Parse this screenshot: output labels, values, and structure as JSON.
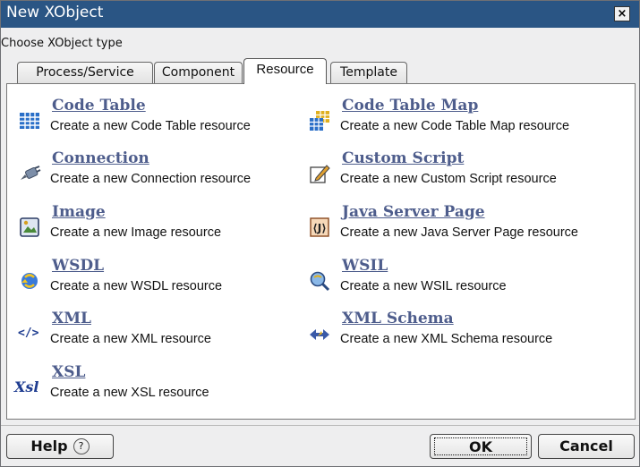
{
  "window": {
    "title": "New XObject",
    "close_glyph": "×"
  },
  "subtitle": "Choose XObject type",
  "tabs": [
    {
      "label": "Process/Service",
      "active": false
    },
    {
      "label": "Component",
      "active": false
    },
    {
      "label": "Resource",
      "active": true
    },
    {
      "label": "Template",
      "active": false
    }
  ],
  "items": [
    {
      "name": "Code Table",
      "desc": "Create a new Code Table resource",
      "icon": "code-table-icon"
    },
    {
      "name": "Code Table Map",
      "desc": "Create a new Code Table Map resource",
      "icon": "code-table-map-icon"
    },
    {
      "name": "Connection",
      "desc": "Create a new Connection resource",
      "icon": "connection-icon"
    },
    {
      "name": "Custom Script",
      "desc": "Create a new Custom Script resource",
      "icon": "custom-script-icon"
    },
    {
      "name": "Image",
      "desc": "Create a new Image resource",
      "icon": "image-icon"
    },
    {
      "name": "Java Server Page",
      "desc": "Create a new Java Server Page resource",
      "icon": "java-server-page-icon"
    },
    {
      "name": "WSDL",
      "desc": "Create a new WSDL resource",
      "icon": "wsdl-icon"
    },
    {
      "name": "WSIL",
      "desc": "Create a new WSIL resource",
      "icon": "wsil-icon"
    },
    {
      "name": "XML",
      "desc": "Create a new XML resource",
      "icon": "xml-icon",
      "icon_text": "</>"
    },
    {
      "name": "XML Schema",
      "desc": "Create a new XML Schema resource",
      "icon": "xml-schema-icon"
    },
    {
      "name": "XSL",
      "desc": "Create a new XSL resource",
      "icon": "xsl-icon",
      "icon_text": "Xsl"
    }
  ],
  "buttons": {
    "help": "Help",
    "help_glyph": "?",
    "ok": "OK",
    "cancel": "Cancel"
  },
  "colors": {
    "titlebar": "#2a5584",
    "link": "#4e5d8c"
  }
}
